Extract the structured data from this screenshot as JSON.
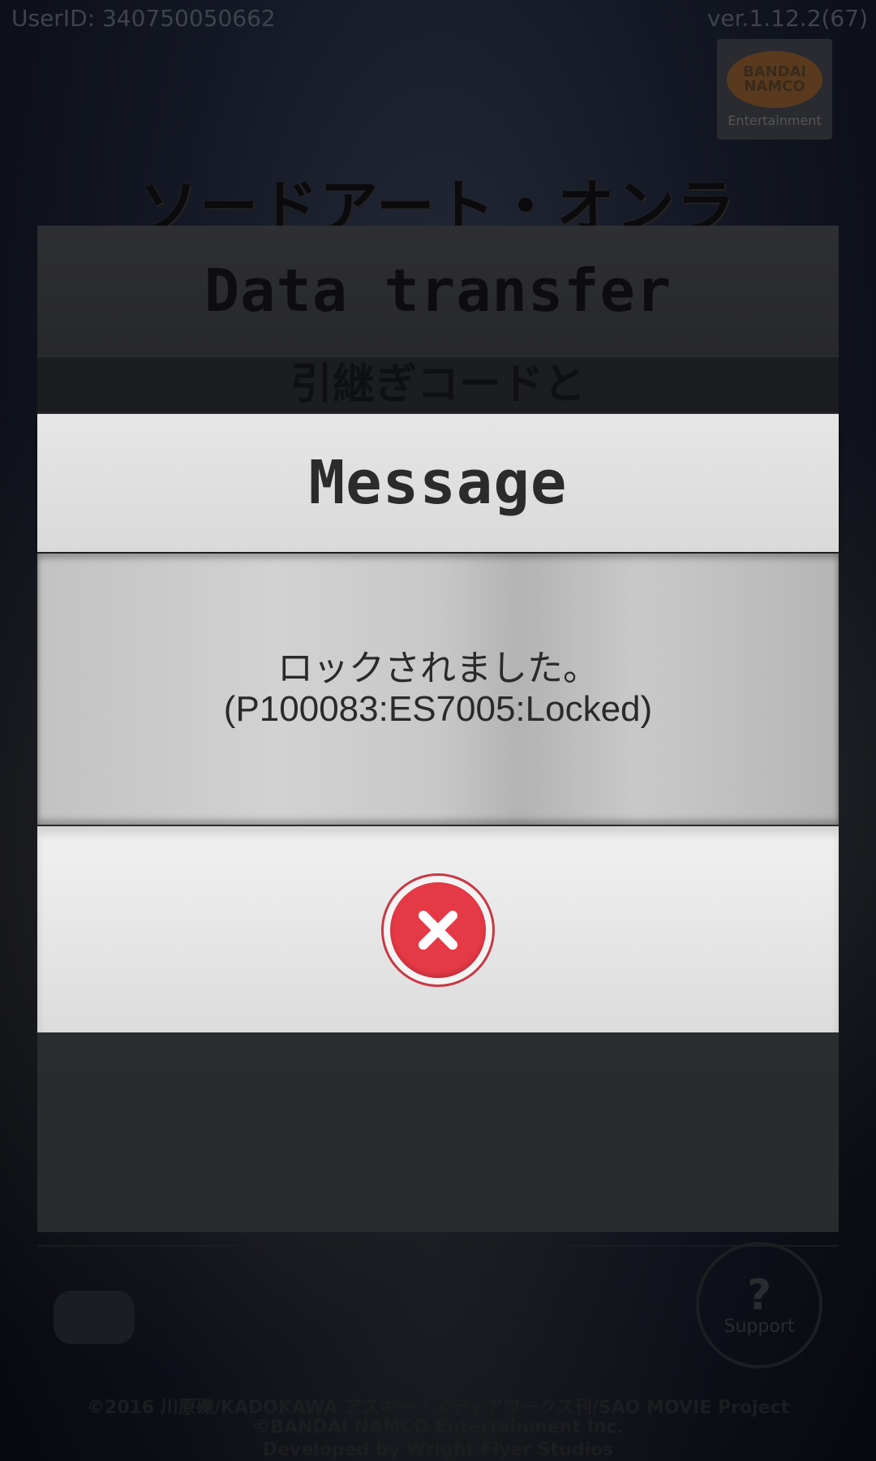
{
  "status": {
    "user_id": "UserID: 340750050662",
    "version": "ver.1.12.2(67)"
  },
  "branding": {
    "logo_text": "BANDAI NAMCO",
    "logo_subtext": "Entertainment",
    "game_title": "ソードアート・オンライン"
  },
  "data_transfer_panel": {
    "title": "Data transfer",
    "instruction_line": "引継ぎコードと"
  },
  "message_dialog": {
    "title": "Message",
    "text_line_1": "ロックされました。",
    "text_line_2": "(P100083:ES7005:Locked)",
    "close_icon": "close-x-icon",
    "accent_color": "#e63946"
  },
  "footer": {
    "support_label": "Support",
    "support_symbol": "?",
    "copyright_1": "©2016 川原礫/KADOKAWA アスキー・メディアワークス刊/SAO MOVIE Project",
    "copyright_2": "©BANDAI NAMCO Entertainment Inc.",
    "copyright_3": "Developed by Wright Flyer Studios"
  }
}
